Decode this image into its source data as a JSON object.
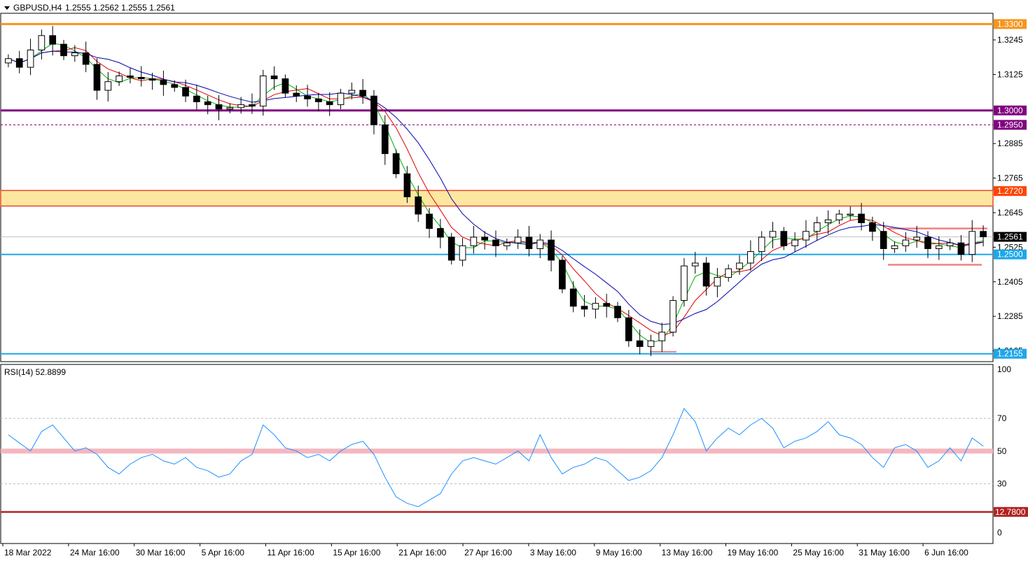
{
  "header": {
    "symbol_timeframe": "GBPUSD,H4",
    "ohlc": "1.2555 1.2562 1.2555 1.2561",
    "menu_icon": "triangle-down-icon"
  },
  "indicator": {
    "label": "RSI(14) 52.8899"
  },
  "price_axis": {
    "ticks": [
      "1.3245",
      "1.3125",
      "1.2885",
      "1.2765",
      "1.2645",
      "1.2525",
      "1.2405",
      "1.2285",
      "1.2165"
    ]
  },
  "price_tags": [
    {
      "label": "1.3300",
      "value": 1.33,
      "bg": "#f7941d",
      "fg": "#ffffff"
    },
    {
      "label": "1.3000",
      "value": 1.3,
      "bg": "#800080",
      "fg": "#ffffff"
    },
    {
      "label": "1.2950",
      "value": 1.295,
      "bg": "#800080",
      "fg": "#ffffff"
    },
    {
      "label": "1.2720",
      "value": 1.272,
      "bg": "#ff4500",
      "fg": "#ffffff"
    },
    {
      "label": "1.2561",
      "value": 1.2561,
      "bg": "#000000",
      "fg": "#ffffff"
    },
    {
      "label": "1.2500",
      "value": 1.25,
      "bg": "#1ea7e8",
      "fg": "#ffffff"
    },
    {
      "label": "1.2155",
      "value": 1.2155,
      "bg": "#1ea7e8",
      "fg": "#ffffff"
    }
  ],
  "rsi_axis": {
    "ticks": [
      "100",
      "70",
      "50",
      "30",
      "0"
    ],
    "tag": {
      "label": "12.7800",
      "bg": "#b22222",
      "fg": "#ffffff"
    }
  },
  "time_axis": {
    "labels": [
      "18 Mar 2022",
      "24 Mar 16:00",
      "30 Mar 16:00",
      "5 Apr 16:00",
      "11 Apr 16:00",
      "15 Apr 16:00",
      "21 Apr 16:00",
      "27 Apr 16:00",
      "3 May 16:00",
      "9 May 16:00",
      "13 May 16:00",
      "19 May 16:00",
      "25 May 16:00",
      "31 May 16:00",
      "6 Jun 16:00"
    ]
  },
  "colors": {
    "support_line": "#1ea7e8",
    "level_1300": "#800080",
    "level_1330": "#f7941d",
    "zone_fill": "#fde7a0",
    "zone_border": "#e8482c",
    "range_lines": "#f08080",
    "ma_fast": "#00b000",
    "ma_mid": "#e00000",
    "ma_slow": "#0000b0",
    "rsi_line": "#1e90ff",
    "rsi_50_band": "#f4b7c0",
    "rsi_low_line": "#b22222"
  },
  "chart_data": {
    "type": "candlestick",
    "symbol": "GBPUSD",
    "timeframe": "H4",
    "ylim": [
      1.213,
      1.3335
    ],
    "horizontal_levels": [
      1.33,
      1.3,
      1.295,
      1.25,
      1.2155
    ],
    "zone": [
      1.2668,
      1.2722
    ],
    "range_box": {
      "top": 1.259,
      "bottom": 1.2464
    },
    "closes": [
      1.318,
      1.315,
      1.321,
      1.326,
      1.323,
      1.319,
      1.32,
      1.316,
      1.307,
      1.31,
      1.312,
      1.3115,
      1.311,
      1.3105,
      1.309,
      1.308,
      1.305,
      1.303,
      1.302,
      1.3005,
      1.301,
      1.302,
      1.3015,
      1.312,
      1.311,
      1.306,
      1.305,
      1.304,
      1.303,
      1.302,
      1.306,
      1.307,
      1.305,
      1.295,
      1.285,
      1.278,
      1.27,
      1.264,
      1.259,
      1.256,
      1.248,
      1.253,
      1.256,
      1.255,
      1.253,
      1.254,
      1.256,
      1.252,
      1.255,
      1.248,
      1.238,
      1.232,
      1.231,
      1.233,
      1.232,
      1.228,
      1.22,
      1.218,
      1.22,
      1.223,
      1.234,
      1.246,
      1.247,
      1.239,
      1.242,
      1.245,
      1.247,
      1.251,
      1.256,
      1.258,
      1.253,
      1.255,
      1.258,
      1.261,
      1.262,
      1.264,
      1.264,
      1.261,
      1.258,
      1.252,
      1.253,
      1.255,
      1.256,
      1.252,
      1.253,
      1.254,
      1.25,
      1.258,
      1.2561
    ],
    "rsi": {
      "label": "RSI(14)",
      "last": 52.8899,
      "ylim": [
        0,
        100
      ],
      "levels": [
        70,
        50,
        30
      ],
      "values": [
        60,
        55,
        50,
        62,
        66,
        58,
        50,
        52,
        48,
        40,
        36,
        42,
        46,
        48,
        44,
        42,
        46,
        40,
        38,
        34,
        36,
        44,
        48,
        66,
        60,
        52,
        50,
        46,
        48,
        44,
        50,
        54,
        56,
        48,
        34,
        22,
        18,
        16,
        20,
        24,
        36,
        44,
        46,
        44,
        42,
        46,
        50,
        44,
        60,
        46,
        36,
        40,
        42,
        46,
        44,
        38,
        32,
        34,
        38,
        46,
        60,
        76,
        68,
        50,
        58,
        64,
        60,
        66,
        70,
        64,
        52,
        56,
        58,
        62,
        68,
        60,
        58,
        54,
        46,
        40,
        52,
        54,
        50,
        40,
        44,
        52,
        44,
        58,
        53
      ]
    },
    "x_labels": [
      "18 Mar 2022",
      "24 Mar 16:00",
      "30 Mar 16:00",
      "5 Apr 16:00",
      "11 Apr 16:00",
      "15 Apr 16:00",
      "21 Apr 16:00",
      "27 Apr 16:00",
      "3 May 16:00",
      "9 May 16:00",
      "13 May 16:00",
      "19 May 16:00",
      "25 May 16:00",
      "31 May 16:00",
      "6 Jun 16:00"
    ]
  }
}
